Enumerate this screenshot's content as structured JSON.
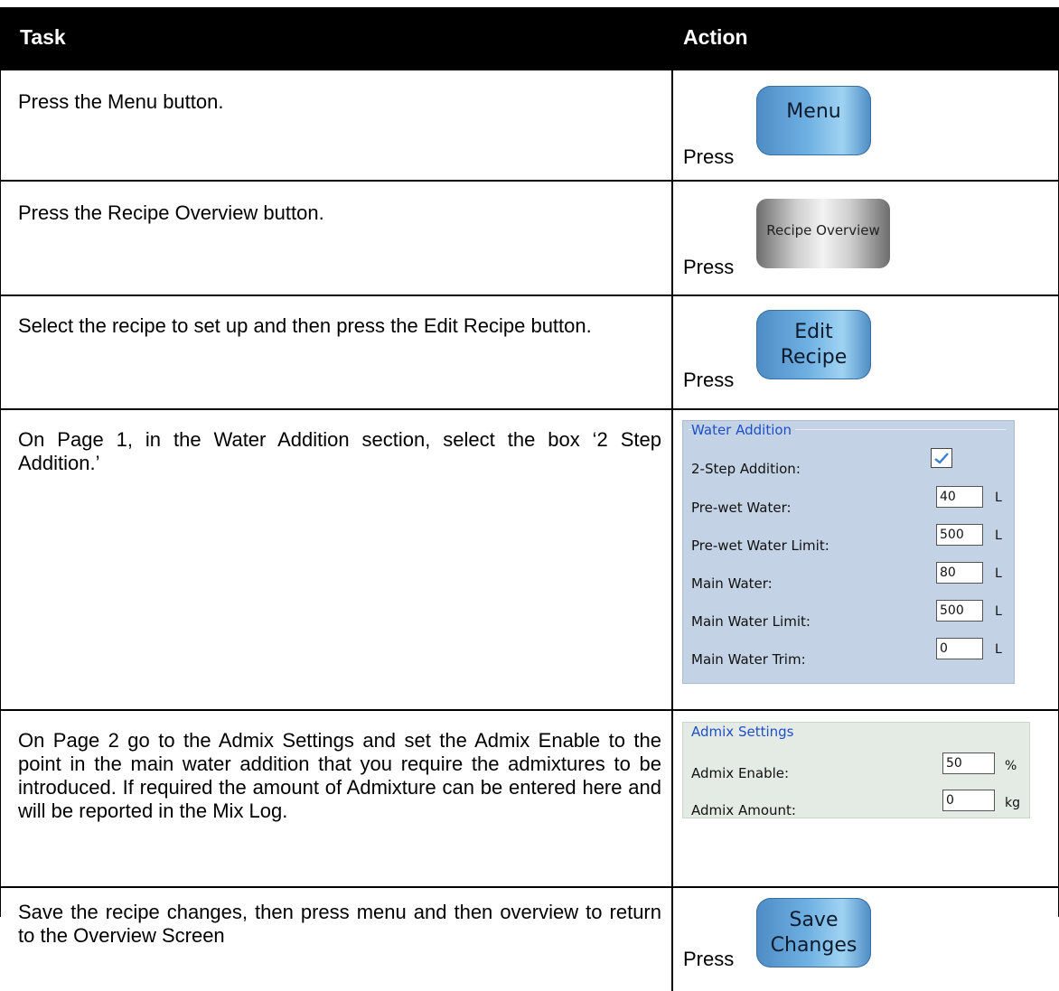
{
  "header": {
    "task": "Task",
    "action": "Action"
  },
  "rows": [
    {
      "task": "Press the Menu button.",
      "press": "Press",
      "button": "Menu"
    },
    {
      "task": "Press the Recipe Overview button.",
      "press": "Press",
      "button": "Recipe Overview"
    },
    {
      "task": "Select the recipe to set up and then press the Edit Recipe button.",
      "press": "Press",
      "button_line1": "Edit",
      "button_line2": "Recipe"
    },
    {
      "task": "On Page 1, in the Water Addition section, select the box ‘2 Step Addition.’"
    },
    {
      "task": "On Page 2 go to the Admix Settings and set the Admix Enable to the point in the main water addition that you require the admixtures to be introduced.  If required the amount of Admixture can be entered here and will be reported in the Mix Log."
    },
    {
      "task": "Save the recipe changes, then press menu and then overview to return to the Overview Screen",
      "press": "Press",
      "button_line1": "Save",
      "button_line2": "Changes"
    }
  ],
  "water_addition": {
    "title": "Water Addition",
    "two_step_label": "2-Step Addition:",
    "two_step_checked": true,
    "fields": [
      {
        "label": "Pre-wet Water:",
        "value": "40",
        "unit": "L"
      },
      {
        "label": "Pre-wet Water Limit:",
        "value": "500",
        "unit": "L"
      },
      {
        "label": "Main Water:",
        "value": "80",
        "unit": "L"
      },
      {
        "label": "Main Water Limit:",
        "value": "500",
        "unit": "L"
      },
      {
        "label": "Main Water Trim:",
        "value": "0",
        "unit": "L"
      }
    ]
  },
  "admix_settings": {
    "title": "Admix Settings",
    "fields": [
      {
        "label": "Admix Enable:",
        "value": "50",
        "unit": "%"
      },
      {
        "label": "Admix Amount:",
        "value": "0",
        "unit": "kg"
      }
    ]
  }
}
